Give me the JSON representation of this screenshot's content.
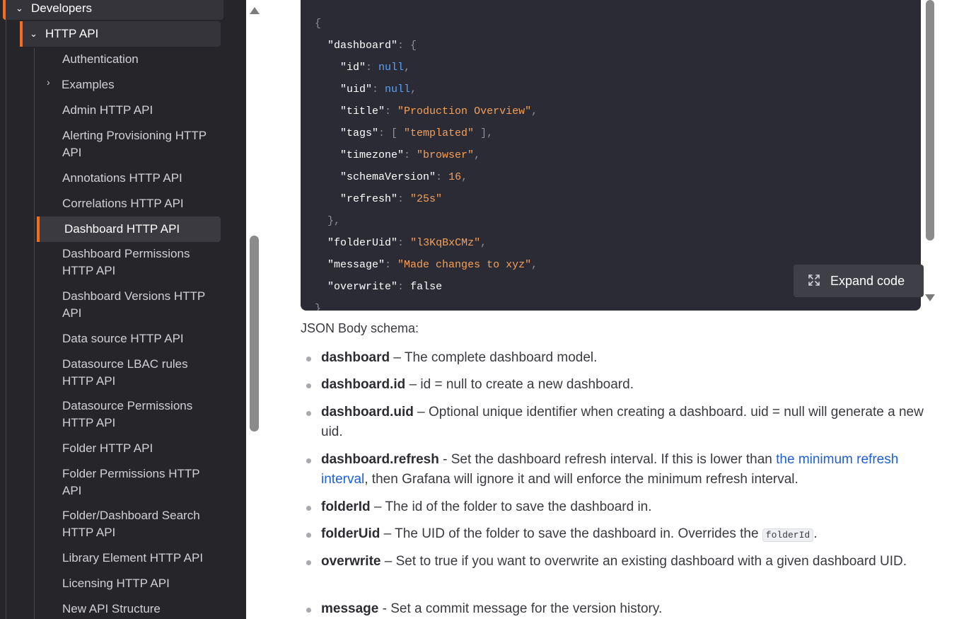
{
  "sidebar": {
    "developers_label": "Developers",
    "http_api_label": "HTTP API",
    "items": [
      "Authentication",
      "Examples",
      "Admin HTTP API",
      "Alerting Provisioning HTTP API",
      "Annotations HTTP API",
      "Correlations HTTP API",
      "Dashboard HTTP API",
      "Dashboard Permissions HTTP API",
      "Dashboard Versions HTTP API",
      "Data source HTTP API",
      "Datasource LBAC rules HTTP API",
      "Datasource Permissions HTTP API",
      "Folder HTTP API",
      "Folder Permissions HTTP API",
      "Folder/Dashboard Search HTTP API",
      "Library Element HTTP API",
      "Licensing HTTP API",
      "New API Structure"
    ],
    "active_item": "Dashboard HTTP API",
    "accent_color": "#f46c1c"
  },
  "code": {
    "dashboard_key": "\"dashboard\"",
    "id_key": "\"id\"",
    "id_val": "null",
    "uid_key": "\"uid\"",
    "uid_val": "null",
    "title_key": "\"title\"",
    "title_val": "\"Production Overview\"",
    "tags_key": "\"tags\"",
    "tags_val": "\"templated\"",
    "timezone_key": "\"timezone\"",
    "timezone_val": "\"browser\"",
    "schema_key": "\"schemaVersion\"",
    "schema_val": "16",
    "refresh_key": "\"refresh\"",
    "refresh_val": "\"25s\"",
    "folderuid_key": "\"folderUid\"",
    "folderuid_val": "\"l3KqBxCMz\"",
    "message_key": "\"message\"",
    "message_val": "\"Made changes to xyz\"",
    "overwrite_key": "\"overwrite\"",
    "overwrite_val": "false",
    "expand_label": "Expand code"
  },
  "schema": {
    "heading": "JSON Body schema:",
    "bullets": [
      {
        "term": "dashboard",
        "sep": " – ",
        "text": "The complete dashboard model."
      },
      {
        "term": "dashboard.id",
        "sep": " – ",
        "text": "id = null to create a new dashboard."
      },
      {
        "term": "dashboard.uid",
        "sep": " – ",
        "text": "Optional unique identifier when creating a dashboard. uid = null will generate a new uid."
      },
      {
        "term": "dashboard.refresh",
        "sep": " - ",
        "text_before": "Set the dashboard refresh interval. If this is lower than ",
        "link": "the minimum refresh interval",
        "text_after": ", then Grafana will ignore it and will enforce the minimum refresh interval."
      },
      {
        "term": "folderId",
        "sep": " – ",
        "text": "The id of the folder to save the dashboard in."
      },
      {
        "term": "folderUid",
        "sep": " – ",
        "text_before": "The UID of the folder to save the dashboard in. Overrides the ",
        "code": "folderId",
        "text_after": "."
      },
      {
        "term": "overwrite",
        "sep": " – ",
        "text": "Set to true if you want to overwrite an existing dashboard with a given dashboard UID."
      },
      {
        "term": "message",
        "sep": " - ",
        "text": "Set a commit message for the version history."
      }
    ]
  }
}
